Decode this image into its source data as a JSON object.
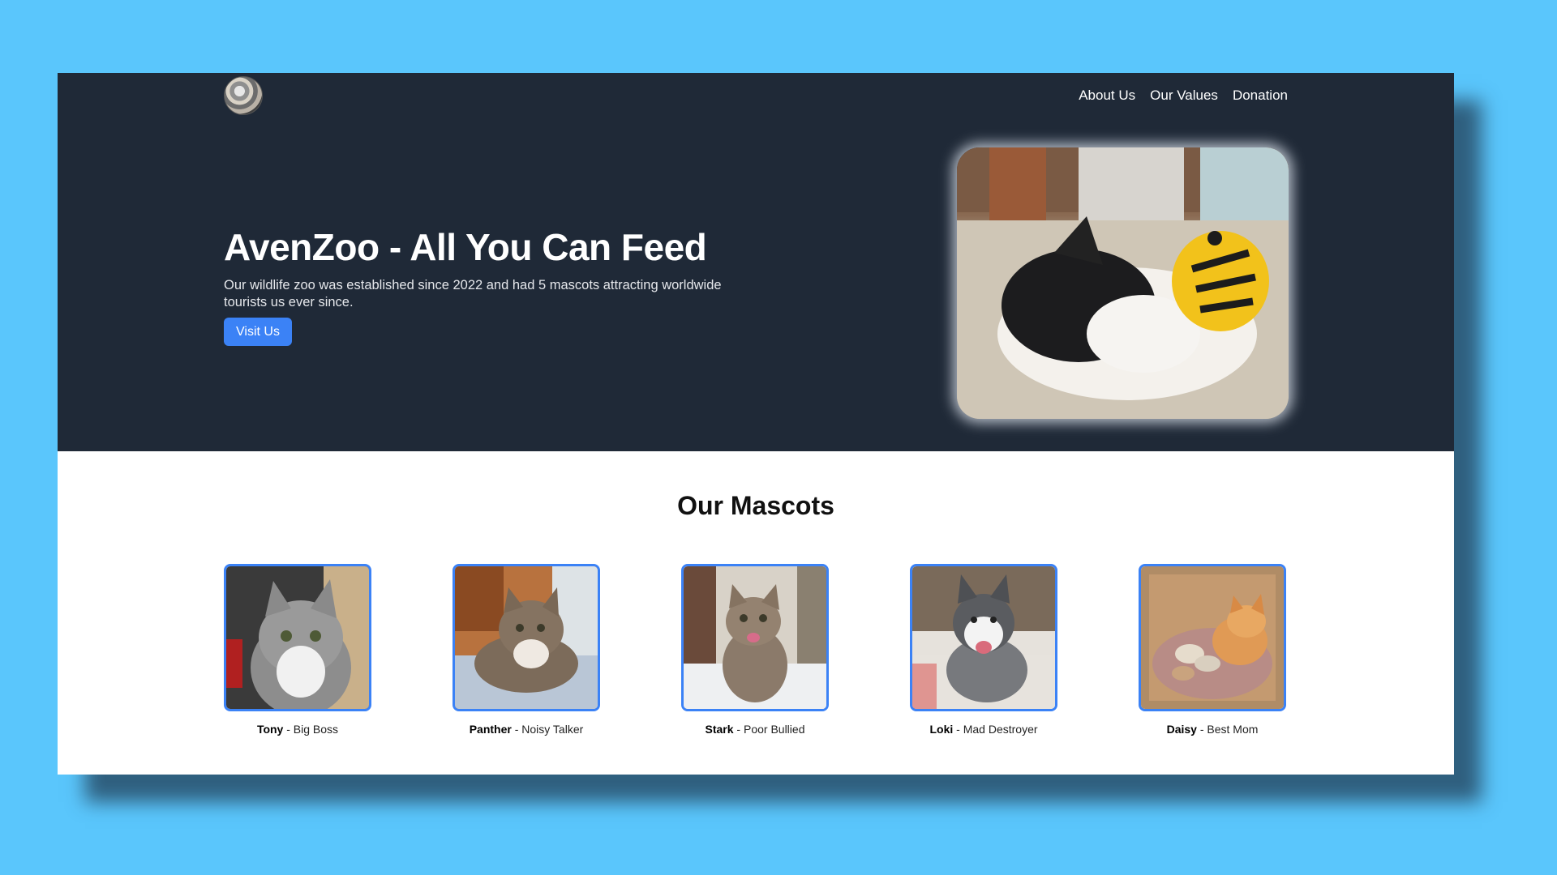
{
  "header": {
    "logo_icon": "mascot-avatar-icon",
    "nav": [
      {
        "label": "About Us"
      },
      {
        "label": "Our Values"
      },
      {
        "label": "Donation"
      }
    ]
  },
  "hero": {
    "title": "AvenZoo - All You Can Feed",
    "subtitle": "Our wildlife zoo was established since 2022 and had 5 mascots attracting worldwide tourists us ever since.",
    "button_label": "Visit Us",
    "image_icon": "sleeping-husky-puppy-photo"
  },
  "mascots_section": {
    "title": "Our Mascots",
    "items": [
      {
        "name": "Tony",
        "role": " - Big Boss",
        "image_icon": "tabby-cat-photo"
      },
      {
        "name": "Panther",
        "role": " - Noisy Talker",
        "image_icon": "lying-tabby-cat-photo"
      },
      {
        "name": "Stark",
        "role": " - Poor Bullied",
        "image_icon": "sitting-tabby-cat-photo"
      },
      {
        "name": "Loki",
        "role": " - Mad Destroyer",
        "image_icon": "husky-dog-photo"
      },
      {
        "name": "Daisy",
        "role": " - Best Mom",
        "image_icon": "orange-cat-with-kittens-photo"
      }
    ]
  },
  "colors": {
    "page_background": "#5ac6fc",
    "hero_background": "#1f2937",
    "accent": "#3b82f6"
  }
}
